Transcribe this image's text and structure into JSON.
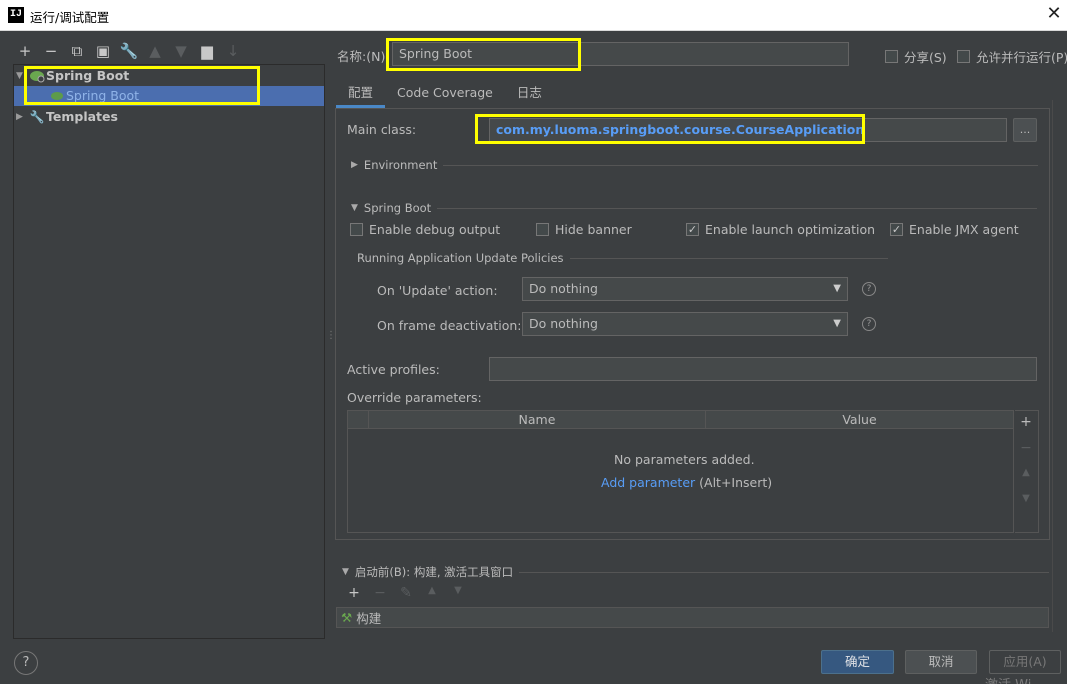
{
  "window": {
    "title": "运行/调试配置",
    "app_icon": "IJ",
    "close_glyph": "✕"
  },
  "left_toolbar": {
    "add": "+",
    "remove": "−",
    "copy": "⧉",
    "save": "▣",
    "edit": "🔧",
    "up": "▲",
    "down": "▼",
    "folder": "▆",
    "sort": "↓"
  },
  "tree": {
    "group_label": "Spring Boot",
    "child_label": "Spring Boot",
    "templates_label": "Templates"
  },
  "name_label": "名称:(N)",
  "name_value": "Spring Boot",
  "share_label": "分享(S)",
  "parallel_label": "允许并行运行(P)",
  "tabs": [
    "配置",
    "Code Coverage",
    "日志"
  ],
  "main_class": {
    "label": "Main class:",
    "value": "com.my.luoma.springboot.course.CourseApplication",
    "browse": "..."
  },
  "environment_label": "Environment",
  "spring_boot_section": "Spring Boot",
  "options": {
    "debug_output": {
      "label": "Enable debug output",
      "checked": false
    },
    "hide_banner": {
      "label": "Hide banner",
      "checked": false
    },
    "launch_opt": {
      "label": "Enable launch optimization",
      "checked": true
    },
    "jmx_agent": {
      "label": "Enable JMX agent",
      "checked": true
    }
  },
  "update_policies": {
    "title": "Running Application Update Policies",
    "on_update_label": "On 'Update' action:",
    "on_update_value": "Do nothing",
    "on_frame_label": "On frame deactivation:",
    "on_frame_value": "Do nothing"
  },
  "active_profiles_label": "Active profiles:",
  "active_profiles_value": "",
  "override": {
    "label": "Override parameters:",
    "columns": [
      "Name",
      "Value"
    ],
    "empty_text": "No parameters added.",
    "add_link": "Add parameter",
    "add_shortcut": "(Alt+Insert)"
  },
  "before_launch": {
    "label": "启动前(B): 构建, 激活工具窗口",
    "build_item": "构建"
  },
  "buttons": {
    "ok": "确定",
    "cancel": "取消",
    "apply": "应用(A)"
  },
  "help": "?",
  "watermark": "激活 Wi",
  "colors": {
    "highlight": "#ffff00",
    "accent": "#4b6eaf",
    "link": "#589df6"
  }
}
